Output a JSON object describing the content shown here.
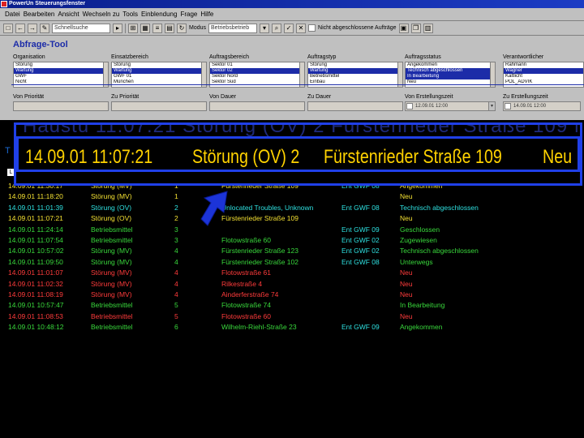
{
  "window": {
    "title": "PowerUn Steuerungsfenster"
  },
  "menu": [
    "Datei",
    "Bearbeiten",
    "Ansicht",
    "Wechseln zu",
    "Tools",
    "Einblendung",
    "Frage",
    "Hilfe"
  ],
  "toolbar": {
    "search_value": "Schnellsuche",
    "mode_label": "Modus",
    "mode_value": "Betriebsbetrieb",
    "checkbox_label": "Nicht abgeschlossene Aufträge"
  },
  "query": {
    "title": "Abfrage-Tool",
    "columns": [
      {
        "label": "Organisation",
        "options": [
          "Störung",
          "Wartung",
          "GWF",
          "Nicht"
        ],
        "selected": 1
      },
      {
        "label": "Einsatzbereich",
        "options": [
          "Störung",
          "Wartung",
          "GWF 01",
          "München"
        ],
        "selected": 1
      },
      {
        "label": "Auftragsbereich",
        "options": [
          "Sektor 01",
          "Sektor 02",
          "Sektor Nord",
          "Sektor Süd"
        ],
        "selected": 1
      },
      {
        "label": "Auftragstyp",
        "options": [
          "Störung",
          "Wartung",
          "Betriebsmittel",
          "Einbau"
        ],
        "selected": 1
      },
      {
        "label": "Auftragsstatus",
        "options": [
          "Angekommen",
          "Technisch abgeschlossen",
          "In Bearbeitung",
          "Neu"
        ],
        "selected": 1
      },
      {
        "label": "Verantwortlicher",
        "options": [
          "Rahmann",
          "Wagner",
          "Kaltlicht",
          "POL_ADVIK"
        ],
        "selected": 1
      }
    ],
    "row2": [
      {
        "label": "Von Priorität",
        "value": ""
      },
      {
        "label": "Zu Priorität",
        "value": ""
      },
      {
        "label": "Von Dauer",
        "value": ""
      },
      {
        "label": "Zu Dauer",
        "value": ""
      },
      {
        "label": "Von Erstellungszeit",
        "value": "12.09.01 12:00"
      },
      {
        "label": "Zu Erstellungszeit",
        "value": "14.09.01 12:00"
      }
    ]
  },
  "zoom": {
    "ghost": "Haustü 11:07:21 Störung (OV) 2 Fürstenrieder Straße 109 Neu",
    "datetime": "14.09.01 11:07:21",
    "type": "Störung (OV) 2",
    "location": "Fürstenrieder Straße 109",
    "status": "Neu"
  },
  "sidebar": {
    "t": "T",
    "l": "L"
  },
  "table": {
    "rows": [
      {
        "datetime": "14.09.01 11:30:17",
        "type": "Störung (MV)",
        "prio": "1",
        "location": "Fürstenrieder Straße 109",
        "gwf": "Ent GWF 08",
        "status": "Angekommen",
        "color": "yellow"
      },
      {
        "datetime": "14.09.01 11:18:20",
        "type": "Störung (MV)",
        "prio": "1",
        "location": "",
        "gwf": "",
        "status": "Neu",
        "color": "yellow"
      },
      {
        "datetime": "14.09.01 11:01:39",
        "type": "Störung (OV)",
        "prio": "2",
        "location": "Unlocated Troubles, Unknown",
        "gwf": "Ent GWF 08",
        "status": "Technisch abgeschlossen",
        "color": "cyan"
      },
      {
        "datetime": "14.09.01 11:07:21",
        "type": "Störung (OV)",
        "prio": "2",
        "location": "Fürstenrieder Straße 109",
        "gwf": "",
        "status": "Neu",
        "color": "yellow"
      },
      {
        "datetime": "14.09.01 11:24:14",
        "type": "Betriebsmittel",
        "prio": "3",
        "location": "",
        "gwf": "Ent GWF 09",
        "status": "Geschlossen",
        "color": "green"
      },
      {
        "datetime": "14.09.01 11:07:54",
        "type": "Betriebsmittel",
        "prio": "3",
        "location": "Flotowstraße 60",
        "gwf": "Ent GWF 02",
        "status": "Zugewiesen",
        "color": "green"
      },
      {
        "datetime": "14.09.01 10:57:02",
        "type": "Störung (MV)",
        "prio": "4",
        "location": "Fürstenrieder Straße 123",
        "gwf": "Ent GWF 02",
        "status": "Technisch abgeschlossen",
        "color": "green"
      },
      {
        "datetime": "14.09.01 11:09:50",
        "type": "Störung (MV)",
        "prio": "4",
        "location": "Fürstenrieder Straße 102",
        "gwf": "Ent GWF 08",
        "status": "Unterwegs",
        "color": "green"
      },
      {
        "datetime": "14.09.01 11:01:07",
        "type": "Störung (MV)",
        "prio": "4",
        "location": "Flotowstraße 61",
        "gwf": "",
        "status": "Neu",
        "color": "red"
      },
      {
        "datetime": "14.09.01 11:02:32",
        "type": "Störung (MV)",
        "prio": "4",
        "location": "Rilkestraße 4",
        "gwf": "",
        "status": "Neu",
        "color": "red"
      },
      {
        "datetime": "14.09.01 11:08:19",
        "type": "Störung (MV)",
        "prio": "4",
        "location": "Ainderferstraße 74",
        "gwf": "",
        "status": "Neu",
        "color": "red"
      },
      {
        "datetime": "14.09.01 10:57:47",
        "type": "Betriebsmittel",
        "prio": "5",
        "location": "Flotowstraße 74",
        "gwf": "",
        "status": "In Bearbeitung",
        "color": "green"
      },
      {
        "datetime": "14.09.01 11:08:53",
        "type": "Betriebsmittel",
        "prio": "5",
        "location": "Flotowstraße 60",
        "gwf": "",
        "status": "Neu",
        "color": "red"
      },
      {
        "datetime": "14.09.01 10:48:12",
        "type": "Betriebsmittel",
        "prio": "6",
        "location": "Wilhelm-Riehl-Straße 23",
        "gwf": "Ent GWF 09",
        "status": "Angekommen",
        "color": "green"
      }
    ]
  },
  "colors": {
    "accent": "#1c2ca8",
    "zoom_border": "#2040e8",
    "zoom_text": "#ffd200"
  }
}
